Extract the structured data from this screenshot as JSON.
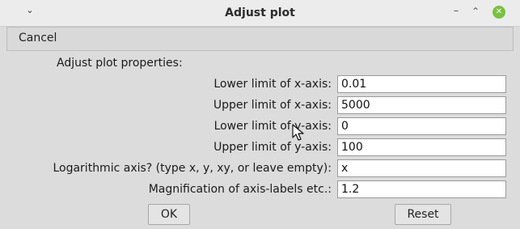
{
  "window": {
    "title": "Adjust plot",
    "menu_icon": "chevron-down-icon",
    "min_icon": "minimize-icon",
    "max_icon": "maximize-icon",
    "close_icon": "close-icon",
    "close_color": "#7ac143"
  },
  "menubar": {
    "cancel_label": "Cancel"
  },
  "form": {
    "heading": "Adjust plot properties:",
    "rows": [
      {
        "label": "Lower limit of x-axis:",
        "value": "0.01"
      },
      {
        "label": "Upper limit of x-axis:",
        "value": "5000"
      },
      {
        "label": "Lower limit of y-axis:",
        "value": "0"
      },
      {
        "label": "Upper limit of y-axis:",
        "value": "100"
      },
      {
        "label": "Logarithmic axis? (type x, y, xy, or leave empty):",
        "value": "x"
      },
      {
        "label": "Magnification of axis-labels etc.:",
        "value": "1.2"
      }
    ]
  },
  "buttons": {
    "ok_label": "OK",
    "reset_label": "Reset"
  },
  "cursor_icon": "mouse-pointer-icon"
}
